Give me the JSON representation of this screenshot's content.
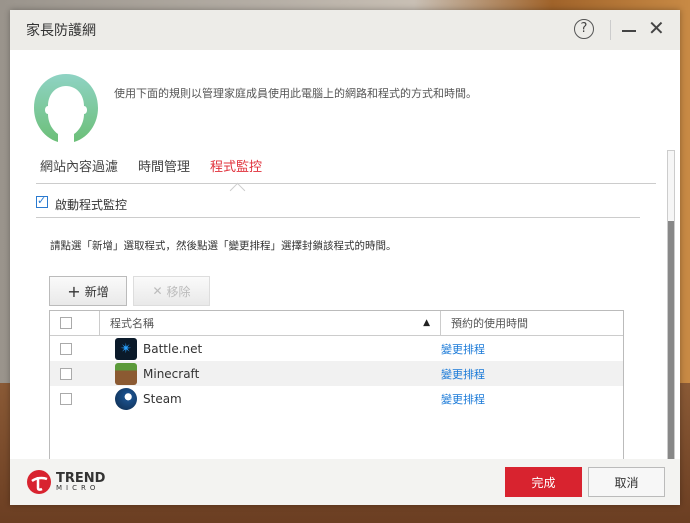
{
  "window": {
    "title": "家長防護網",
    "help": "?",
    "minimize": "–",
    "close": "✕"
  },
  "intro": "使用下面的規則以管理家庭成員使用此電腦上的網路和程式的方式和時間。",
  "tabs": [
    {
      "label": "網站內容過濾"
    },
    {
      "label": "時間管理"
    },
    {
      "label": "程式監控",
      "active": true
    }
  ],
  "enable": {
    "label": "啟動程式監控",
    "checked": true
  },
  "hint": "請點選「新增」選取程式，然後點選「變更排程」選擇封鎖該程式的時間。",
  "toolbar": {
    "add_icon": "+",
    "add": "新增",
    "remove_icon": "✕",
    "remove": "移除"
  },
  "table": {
    "headers": [
      "程式名稱",
      "預約的使用時間"
    ],
    "sort_icon": "▲",
    "rows": [
      {
        "name": "Battle.net",
        "action": "變更排程"
      },
      {
        "name": "Minecraft",
        "action": "變更排程"
      },
      {
        "name": "Steam",
        "action": "變更排程"
      }
    ]
  },
  "footer": {
    "logo_top": "TREND",
    "logo_bottom": "MICRO",
    "done": "完成",
    "cancel": "取消"
  },
  "colors": {
    "accent": "#e0303a",
    "link": "#1a7ad8"
  }
}
